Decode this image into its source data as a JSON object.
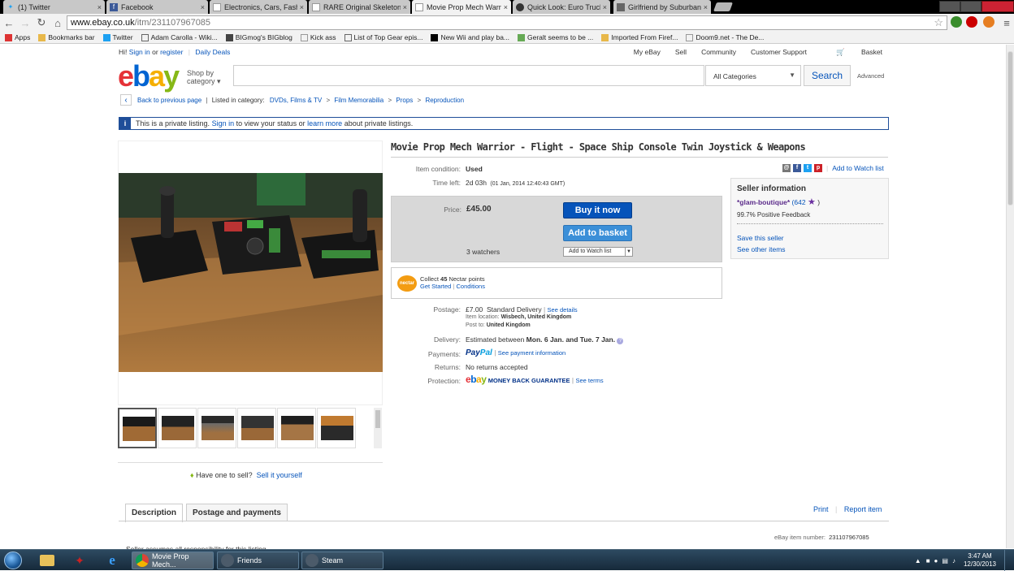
{
  "browser": {
    "tabs": [
      {
        "title": "(1) Twitter",
        "icon": "twitter-icon"
      },
      {
        "title": "Facebook",
        "icon": "facebook-icon"
      },
      {
        "title": "Electronics, Cars, Fashion,",
        "icon": "ebay-icon"
      },
      {
        "title": "RARE Original Skeleton X",
        "icon": "ebay-icon"
      },
      {
        "title": "Movie Prop Mech Warrior",
        "icon": "ebay-icon",
        "active": true
      },
      {
        "title": "Quick Look: Euro Truck Si",
        "icon": "steam-icon"
      },
      {
        "title": "Girlfriend by Suburban All",
        "icon": "site-icon"
      }
    ],
    "url_host": "www.ebay.co.uk",
    "url_path": "/itm/231107967085",
    "bookmarks": [
      "Apps",
      "Bookmarks bar",
      "Twitter",
      "Adam Carolla - Wiki...",
      "BIGmog's BIGblog",
      "Kick ass",
      "List of Top Gear epis...",
      "New Wii and play ba...",
      "Geralt seems to be ...",
      "Imported From Firef...",
      "Doom9.net - The De..."
    ]
  },
  "ebay_header": {
    "greeting_hi": "Hi!",
    "sign_in": "Sign in",
    "or": "or",
    "register": "register",
    "daily_deals": "Daily Deals",
    "right_links": [
      "My eBay",
      "Sell",
      "Community",
      "Customer Support",
      "Basket"
    ],
    "shop_by_line1": "Shop by",
    "shop_by_line2": "category",
    "category_select": "All Categories",
    "search_button": "Search",
    "advanced": "Advanced"
  },
  "breadcrumb": {
    "back": "Back to previous page",
    "listed_in": "Listed in category:",
    "items": [
      "DVDs, Films & TV",
      "Film Memorabilia",
      "Props",
      "Reproduction"
    ]
  },
  "notice": {
    "text_before": "This is a private listing.",
    "sign_in": "Sign in",
    "text_mid": "to view your status or",
    "learn_more": "learn more",
    "text_after": "about private listings."
  },
  "listing": {
    "title": "Movie Prop Mech Warrior - Flight - Space Ship Console Twin Joystick & Weapons",
    "condition_label": "Item condition:",
    "condition": "Used",
    "time_left_label": "Time left:",
    "time_left": "2d 03h",
    "time_left_date": "(01 Jan, 2014  12:40:43 GMT)",
    "price_label": "Price:",
    "price": "£45.00",
    "buy_now": "Buy it now",
    "add_basket": "Add to basket",
    "watchers": "3 watchers",
    "watch_select": "Add to Watch list",
    "add_watch_link": "Add to Watch list",
    "nectar_badge": "nectar",
    "nectar_collect_pre": "Collect",
    "nectar_points": "45",
    "nectar_collect_post": "Nectar points",
    "nectar_started": "Get Started",
    "nectar_conditions": "Conditions",
    "postage_label": "Postage:",
    "postage_price": "£7.00",
    "postage_type": "Standard Delivery",
    "see_details": "See details",
    "item_location_label": "Item location:",
    "item_location": "Wisbech, United Kingdom",
    "post_to_label": "Post to:",
    "post_to": "United Kingdom",
    "delivery_label": "Delivery:",
    "delivery_pre": "Estimated between",
    "delivery_dates": "Mon. 6 Jan. and Tue. 7 Jan.",
    "payments_label": "Payments:",
    "paypal_pay": "Pay",
    "paypal_pal": "Pal",
    "see_payment": "See payment information",
    "returns_label": "Returns:",
    "returns": "No returns accepted",
    "protection_label": "Protection:",
    "mbg": "MONEY BACK GUARANTEE",
    "see_terms": "See terms"
  },
  "seller": {
    "heading": "Seller information",
    "name": "*glam-boutique*",
    "score": "(642",
    "score_close": ")",
    "feedback": "99.7% Positive Feedback",
    "save": "Save this seller",
    "other": "See other items"
  },
  "gallery": {
    "thumb_count": 6,
    "have_one": "Have one to sell?",
    "sell_it": "Sell it yourself"
  },
  "description": {
    "tabs": [
      "Description",
      "Postage and payments"
    ],
    "print": "Print",
    "report": "Report item",
    "item_number_label": "eBay item number:",
    "item_number": "231107967085",
    "seller_assumes": "Seller assumes all responsibility for this listing."
  },
  "taskbar": {
    "tasks": [
      "Movie Prop Mech...",
      "Friends",
      "Steam"
    ],
    "time": "3:47 AM",
    "date": "12/30/2013"
  },
  "colors": {
    "ebay_blue": "#0654ba",
    "buy_button": "#0654ba",
    "basket_button": "#3b8fd8",
    "notice_border": "#1f4e99"
  }
}
